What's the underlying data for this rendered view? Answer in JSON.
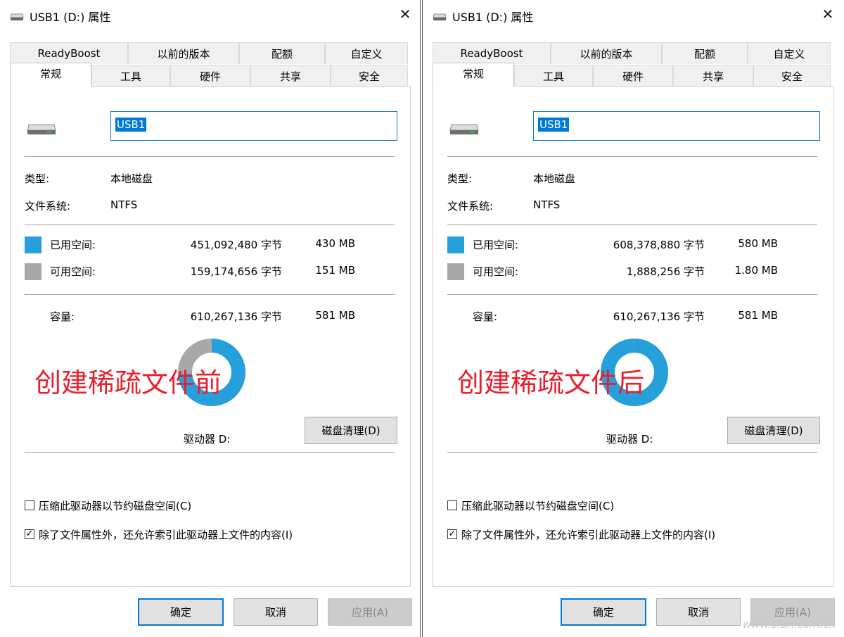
{
  "dialogs": [
    {
      "title": "USB1 (D:) 属性",
      "close_glyph": "✕",
      "tabs_row1": [
        "ReadyBoost",
        "以前的版本",
        "配额",
        "自定义"
      ],
      "tabs_row2": [
        "常规",
        "工具",
        "硬件",
        "共享",
        "安全"
      ],
      "active_tab": "常规",
      "drive_name_value": "USB1",
      "type_label": "类型:",
      "type_value": "本地磁盘",
      "fs_label": "文件系统:",
      "fs_value": "NTFS",
      "used_label": "已用空间:",
      "used_bytes": "451,092,480 字节",
      "used_size": "430 MB",
      "free_label": "可用空间:",
      "free_bytes": "159,174,656 字节",
      "free_size": "151 MB",
      "capacity_label": "容量:",
      "capacity_bytes": "610,267,136 字节",
      "capacity_size": "581 MB",
      "used_fraction": 0.739,
      "annotation": "创建稀疏文件前",
      "drive_caption": "驱动器 D:",
      "cleanup_button": "磁盘清理(D)",
      "compress_checkbox": "压缩此驱动器以节约磁盘空间(C)",
      "compress_checked": false,
      "index_checkbox": "除了文件属性外，还允许索引此驱动器上文件的内容(I)",
      "index_checked": true,
      "ok_button": "确定",
      "cancel_button": "取消",
      "apply_button": "应用(A)"
    },
    {
      "title": "USB1 (D:) 属性",
      "close_glyph": "✕",
      "tabs_row1": [
        "ReadyBoost",
        "以前的版本",
        "配额",
        "自定义"
      ],
      "tabs_row2": [
        "常规",
        "工具",
        "硬件",
        "共享",
        "安全"
      ],
      "active_tab": "常规",
      "drive_name_value": "USB1",
      "type_label": "类型:",
      "type_value": "本地磁盘",
      "fs_label": "文件系统:",
      "fs_value": "NTFS",
      "used_label": "已用空间:",
      "used_bytes": "608,378,880 字节",
      "used_size": "580 MB",
      "free_label": "可用空间:",
      "free_bytes": "1,888,256 字节",
      "free_size": "1.80 MB",
      "capacity_label": "容量:",
      "capacity_bytes": "610,267,136 字节",
      "capacity_size": "581 MB",
      "used_fraction": 0.997,
      "annotation": "创建稀疏文件后",
      "drive_caption": "驱动器 D:",
      "cleanup_button": "磁盘清理(D)",
      "compress_checkbox": "压缩此驱动器以节约磁盘空间(C)",
      "compress_checked": false,
      "index_checkbox": "除了文件属性外，还允许索引此驱动器上文件的内容(I)",
      "index_checked": true,
      "ok_button": "确定",
      "cancel_button": "取消",
      "apply_button": "应用(A)"
    }
  ],
  "colors": {
    "used": "#26a0da",
    "free": "#a8a8a8",
    "annotation": "#e8202c",
    "selection": "#0078d7"
  },
  "watermark": "www.cfan.com.cn"
}
